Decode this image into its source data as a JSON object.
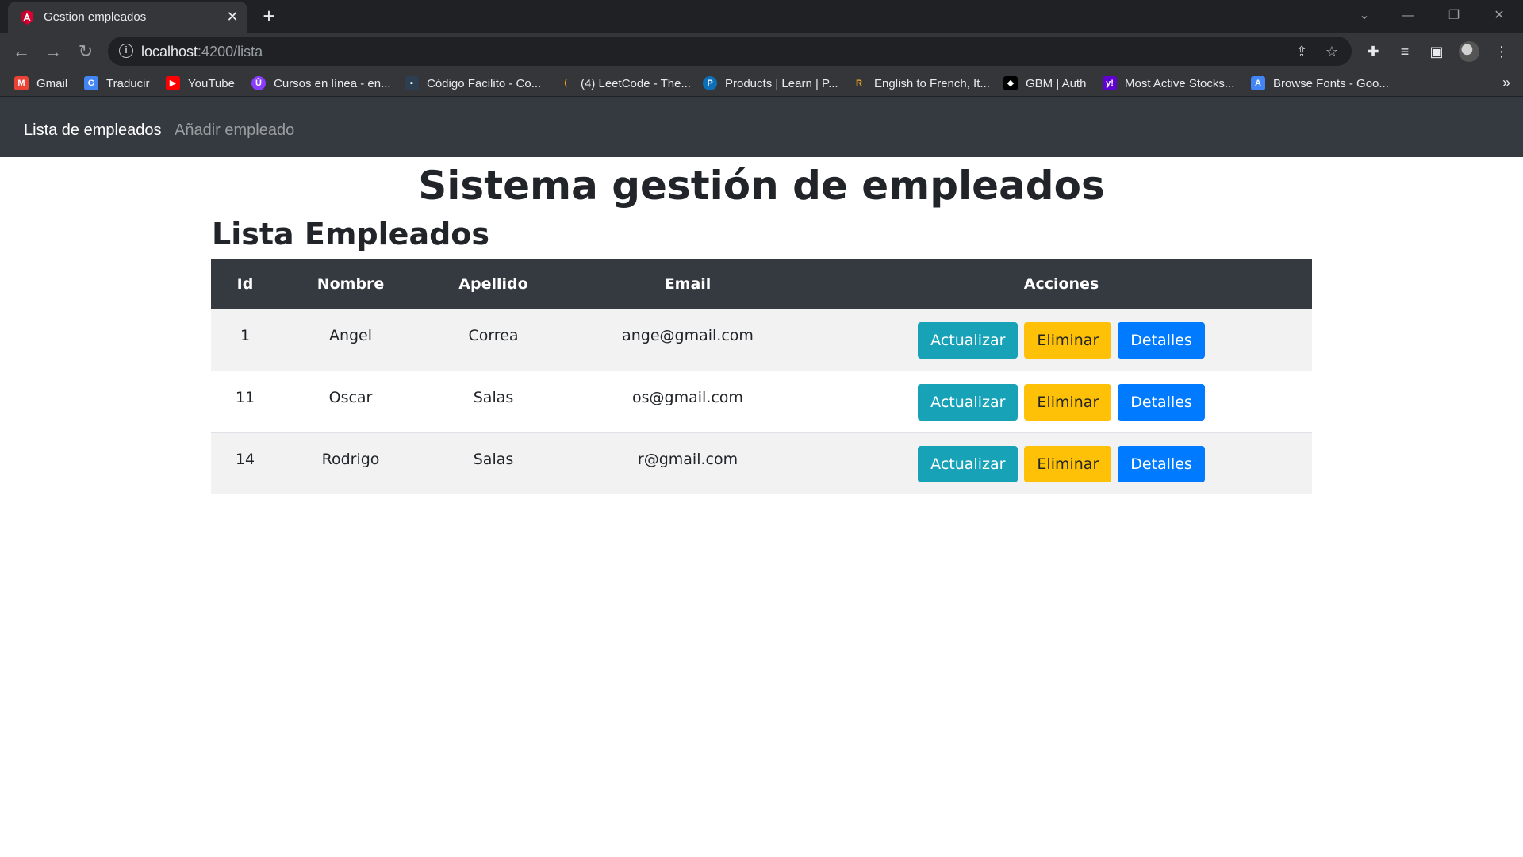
{
  "browser": {
    "tab_title": "Gestion empleados",
    "url_host": "localhost",
    "url_path": ":4200/lista",
    "bookmarks": [
      {
        "label": "Gmail",
        "icon": "gmail-icon",
        "color": "#ea4335"
      },
      {
        "label": "Traducir",
        "icon": "translate-icon",
        "color": "#4285f4"
      },
      {
        "label": "YouTube",
        "icon": "youtube-icon",
        "color": "#ff0000"
      },
      {
        "label": "Cursos en línea - en...",
        "icon": "course-icon",
        "color": "#8b3dff"
      },
      {
        "label": "Código Facilito - Co...",
        "icon": "codigofacilito-icon",
        "color": "#2d3e50"
      },
      {
        "label": "(4) LeetCode - The...",
        "icon": "leetcode-icon",
        "color": "#ffa116"
      },
      {
        "label": "Products | Learn | P...",
        "icon": "pearson-icon",
        "color": "#0d6fb8"
      },
      {
        "label": "English to French, It...",
        "icon": "reverso-icon",
        "color": "#2f64d6"
      },
      {
        "label": "GBM | Auth",
        "icon": "gbm-icon",
        "color": "#000000"
      },
      {
        "label": "Most Active Stocks...",
        "icon": "yahoo-icon",
        "color": "#6001d2"
      },
      {
        "label": "Browse Fonts - Goo...",
        "icon": "google-fonts-icon",
        "color": "#4285f4"
      }
    ]
  },
  "navbar": {
    "brand": "Lista de empleados",
    "link": "Añadir empleado"
  },
  "page": {
    "title": "Sistema gestión de empleados",
    "subtitle": "Lista Empleados"
  },
  "table": {
    "headers": [
      "Id",
      "Nombre",
      "Apellido",
      "Email",
      "Acciones"
    ],
    "rows": [
      {
        "id": "1",
        "nombre": "Angel",
        "apellido": "Correa",
        "email": "ange@gmail.com"
      },
      {
        "id": "11",
        "nombre": "Oscar",
        "apellido": "Salas",
        "email": "os@gmail.com"
      },
      {
        "id": "14",
        "nombre": "Rodrigo",
        "apellido": "Salas",
        "email": "r@gmail.com"
      }
    ],
    "actions": {
      "update": "Actualizar",
      "delete": "Eliminar",
      "details": "Detalles"
    }
  },
  "colors": {
    "navbar_bg": "#343a40",
    "btn_info": "#17a2b8",
    "btn_warning": "#ffc107",
    "btn_primary": "#007bff"
  }
}
